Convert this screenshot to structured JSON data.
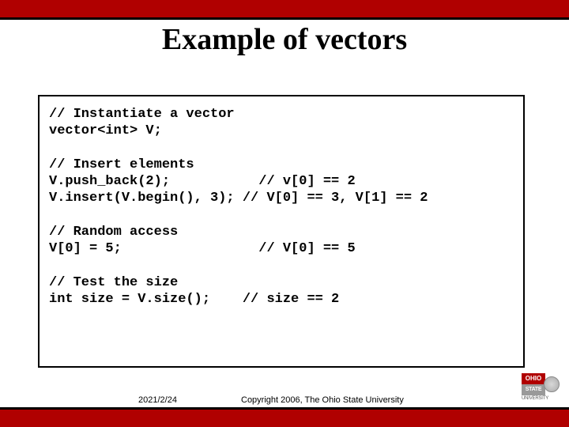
{
  "title": "Example of vectors",
  "code": "// Instantiate a vector\nvector<int> V;\n\n// Insert elements\nV.push_back(2);           // v[0] == 2\nV.insert(V.begin(), 3); // V[0] == 3, V[1] == 2\n\n// Random access\nV[0] = 5;                 // V[0] == 5\n\n// Test the size\nint size = V.size();    // size == 2",
  "footer": {
    "date": "2021/2/24",
    "copyright": "Copyright 2006, The Ohio State University"
  },
  "logo": {
    "line1": "OHIO",
    "line2": "STATE",
    "line3": "UNIVERSITY"
  }
}
